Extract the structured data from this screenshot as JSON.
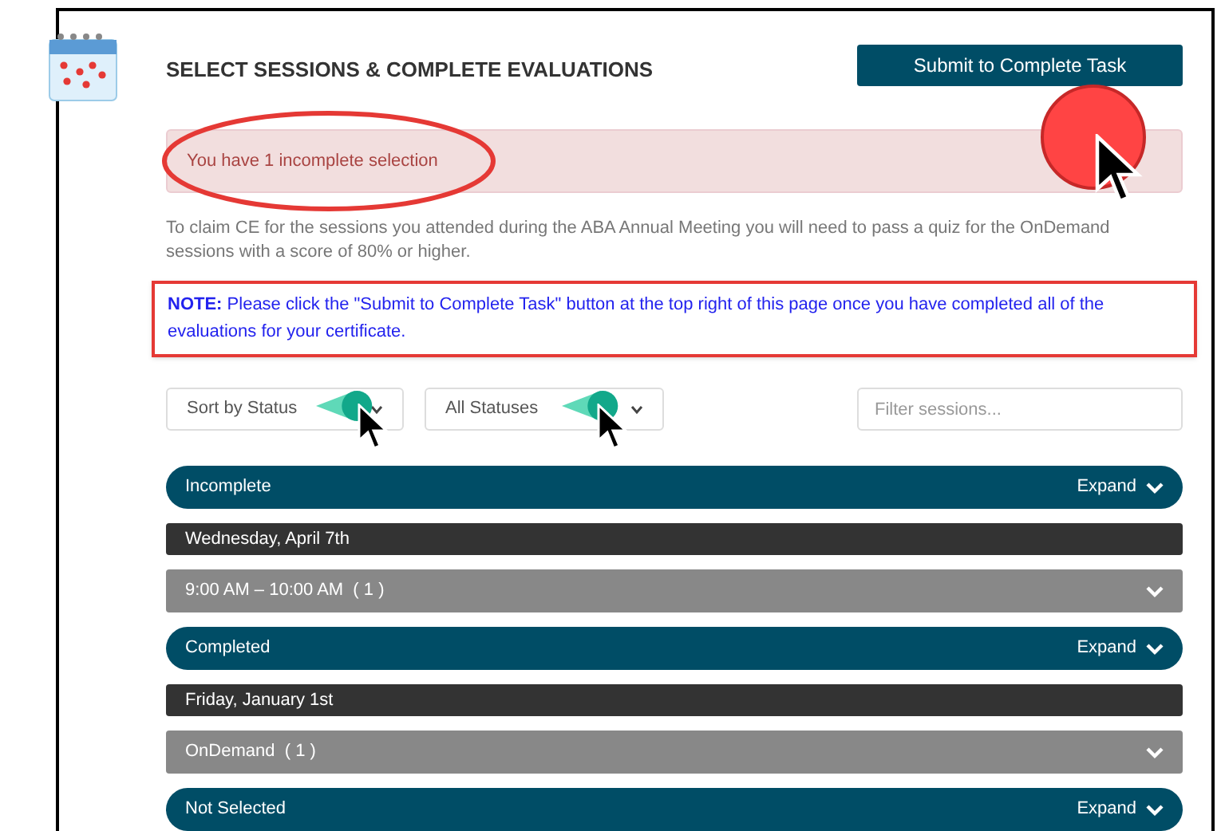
{
  "header": {
    "title": "SELECT SESSIONS & COMPLETE EVALUATIONS",
    "submit_button": "Submit to Complete Task"
  },
  "alert": {
    "text": "You have 1 incomplete selection"
  },
  "intro": "To claim CE for the sessions you attended during the ABA Annual Meeting you will need to pass a quiz for the OnDemand sessions with a score of 80% or higher.",
  "note": "**NOTE:** Please click the \"Submit to Complete Task\" button at the top right of this page once you have completed all of the evaluations for your certificate.",
  "filters": {
    "sort": "Sort by Status",
    "status": "All Statuses",
    "search_placeholder": "Filter sessions..."
  },
  "rows": [
    {
      "kind": "group",
      "label": "Incomplete",
      "action": "Expand"
    },
    {
      "kind": "date",
      "label": "Wednesday, April 7th"
    },
    {
      "kind": "slot",
      "label": "9:00 AM – 10:00 AM  ( 1 )"
    },
    {
      "kind": "group",
      "label": "Completed",
      "action": "Expand"
    },
    {
      "kind": "date",
      "label": "Friday, January 1st"
    },
    {
      "kind": "slot",
      "label": "OnDemand  ( 1 )"
    },
    {
      "kind": "group",
      "label": "Not Selected",
      "action": "Expand"
    }
  ]
}
